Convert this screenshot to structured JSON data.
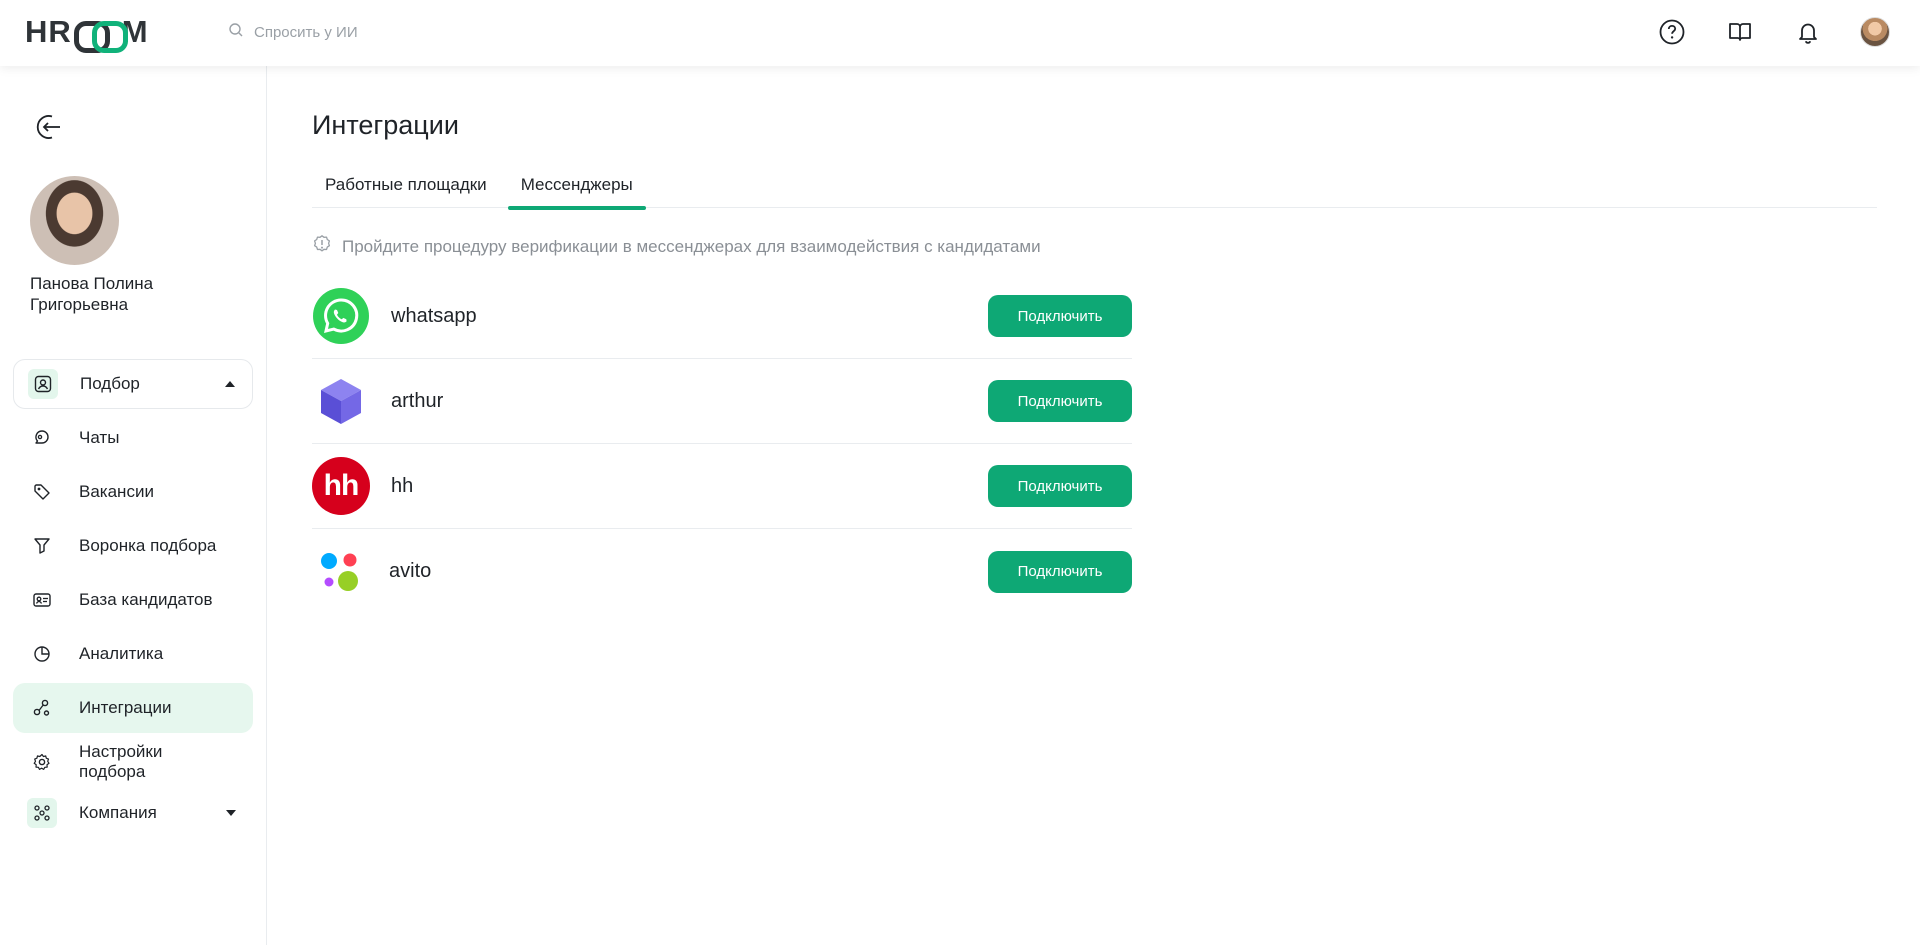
{
  "header": {
    "logo_text": "HROOM",
    "search_placeholder": "Спросить у ИИ",
    "icons": [
      "help-icon",
      "book-icon",
      "bell-icon",
      "profile-avatar"
    ]
  },
  "sidebar": {
    "user_name": "Панова Полина Григорьевна",
    "items": [
      {
        "label": "Подбор",
        "icon": "person-badge-icon"
      },
      {
        "label": "Чаты",
        "icon": "chat-icon"
      },
      {
        "label": "Вакансии",
        "icon": "tag-icon"
      },
      {
        "label": "Воронка подбора",
        "icon": "funnel-icon"
      },
      {
        "label": "База кандидатов",
        "icon": "id-card-icon"
      },
      {
        "label": "Аналитика",
        "icon": "pie-chart-icon"
      },
      {
        "label": "Интеграции",
        "icon": "nodes-icon"
      },
      {
        "label": "Настройки подбора",
        "icon": "gear-icon"
      },
      {
        "label": "Компания",
        "icon": "org-icon"
      }
    ]
  },
  "main": {
    "title": "Интеграции",
    "tabs": [
      {
        "label": "Работные площадки"
      },
      {
        "label": "Мессенджеры"
      }
    ],
    "notice": "Пройдите процедуру верификации в мессенджерах для взаимодействия с кандидатами",
    "integrations": [
      {
        "name": "whatsapp",
        "button": "Подключить"
      },
      {
        "name": "arthur",
        "button": "Подключить"
      },
      {
        "name": "hh",
        "button": "Подключить",
        "logo_text": "hh"
      },
      {
        "name": "avito",
        "button": "Подключить"
      }
    ]
  },
  "colors": {
    "accent": "#0ea875",
    "active_bg": "#e6f7ee",
    "whatsapp": "#2fd158",
    "hh": "#d6001c",
    "arthur": "#6a5de0"
  }
}
